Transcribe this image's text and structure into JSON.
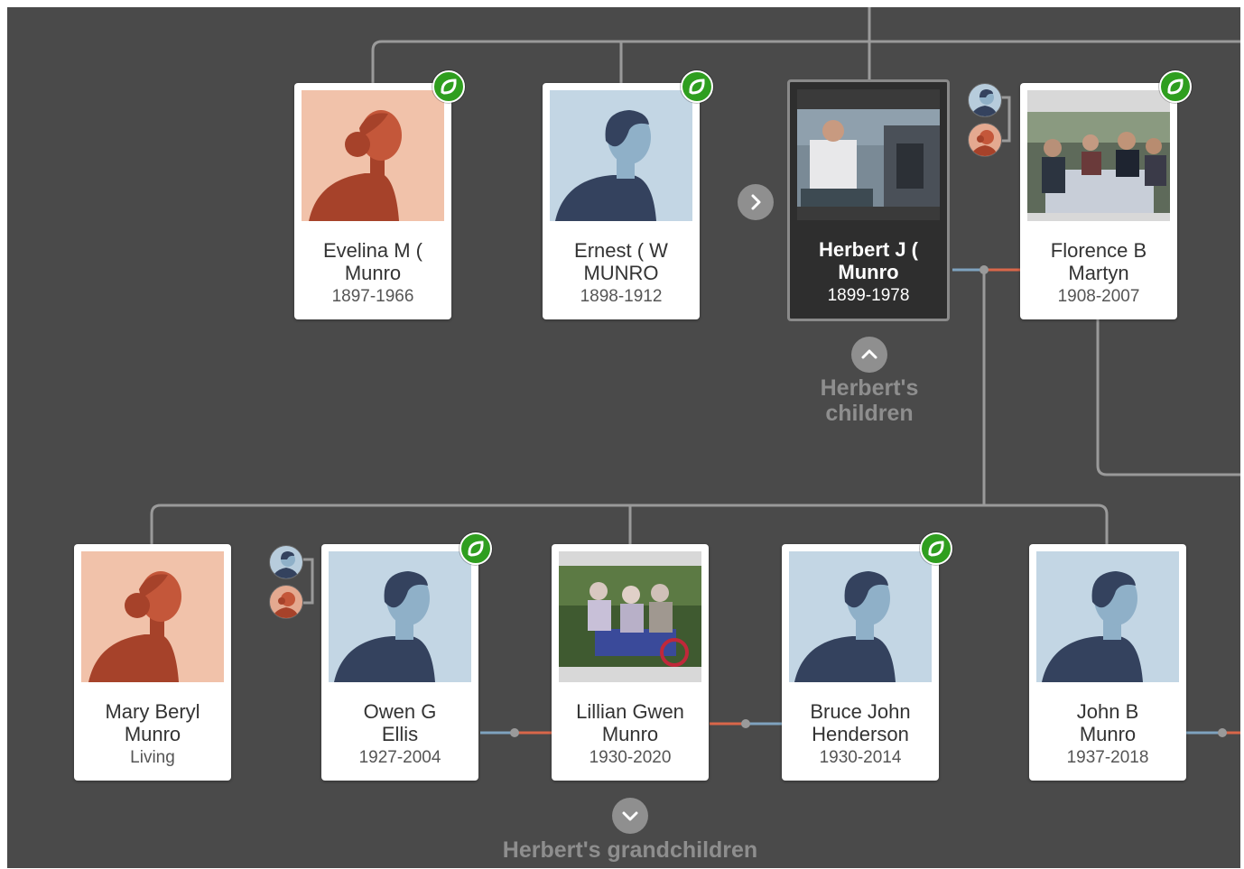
{
  "tree": {
    "parent_generation": [
      {
        "name": "Evelina M (\nMunro",
        "dates": "1897-1966",
        "gender": "female",
        "photo": false,
        "hint": true
      },
      {
        "name": "Ernest ( W\nMUNRO",
        "dates": "1898-1912",
        "gender": "male",
        "photo": false,
        "hint": true
      },
      {
        "name": "Herbert J (\nMunro",
        "dates": "1899-1978",
        "gender": "male",
        "photo": true,
        "hint": false,
        "selected": true
      },
      {
        "name": "Florence B\nMartyn",
        "dates": "1908-2007",
        "gender": "female",
        "photo": true,
        "hint": true
      }
    ],
    "children_generation": [
      {
        "name": "Mary Beryl\nMunro",
        "dates": "Living",
        "gender": "female",
        "photo": false,
        "hint": false
      },
      {
        "name": "Owen G\nEllis",
        "dates": "1927-2004",
        "gender": "male",
        "photo": false,
        "hint": true
      },
      {
        "name": "Lillian Gwen\nMunro",
        "dates": "1930-2020",
        "gender": "female",
        "photo": true,
        "hint": false
      },
      {
        "name": "Bruce John\nHenderson",
        "dates": "1930-2014",
        "gender": "male",
        "photo": false,
        "hint": true
      },
      {
        "name": "John B\nMunro",
        "dates": "1937-2018",
        "gender": "male",
        "photo": false,
        "hint": false
      }
    ],
    "children_caption": "Herbert's\nchildren",
    "grandchildren_caption": "Herbert's grandchildren"
  },
  "colors": {
    "background": "#4a4a4a",
    "line": "#9a9a9a",
    "hint_green": "#2f9e1f",
    "male_bg": "#c3d6e4",
    "male_figure": "#34425e",
    "female_bg": "#f1c2aa",
    "female_figure": "#a6422a",
    "spouse_male_connector": "#7fa3bf",
    "spouse_female_connector": "#d9674a"
  },
  "icons": {
    "hint": "leaf-hint-icon",
    "expand": "chevron-right-icon",
    "collapse_up": "chevron-up-icon",
    "expand_down": "chevron-down-icon",
    "alt_spouse": "spouse-avatars-icon"
  }
}
